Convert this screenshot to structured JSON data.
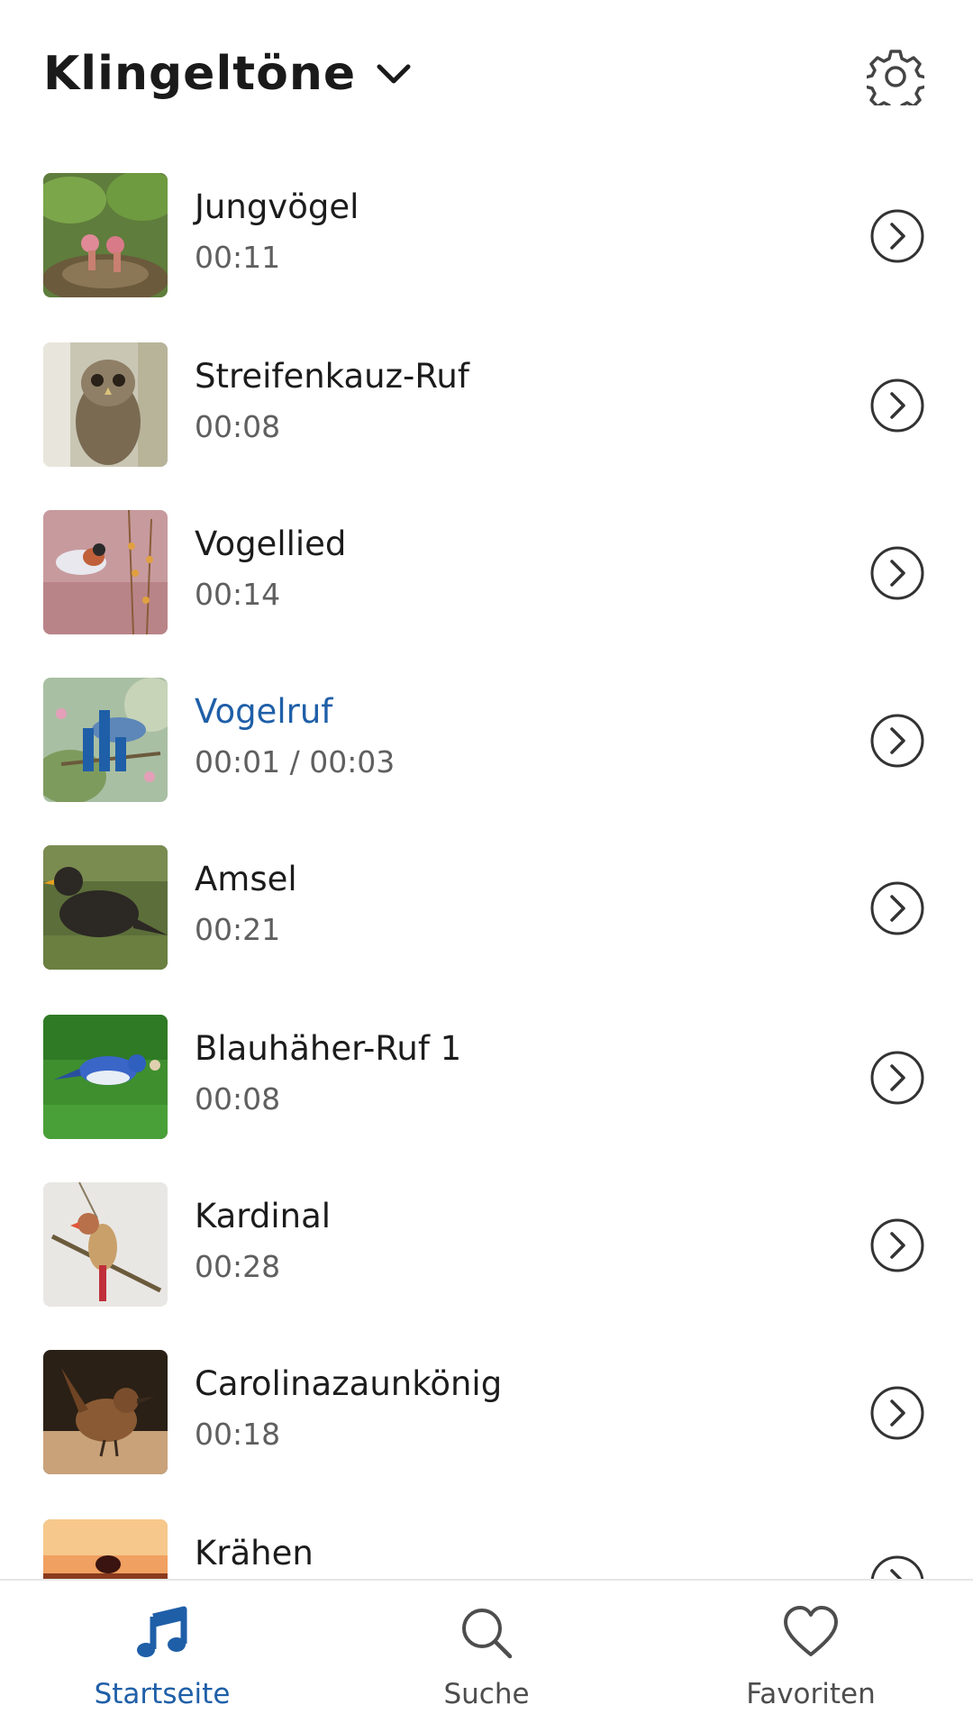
{
  "header": {
    "title": "Klingeltöne"
  },
  "ringtones": [
    {
      "name": "Jungvögel",
      "duration": "00:11"
    },
    {
      "name": "Streifenkauz-Ruf",
      "duration": "00:08"
    },
    {
      "name": "Vogellied",
      "duration": "00:14"
    },
    {
      "name": "Vogelruf",
      "duration": "00:01 / 00:03",
      "playing": true
    },
    {
      "name": "Amsel",
      "duration": "00:21"
    },
    {
      "name": "Blauhäher-Ruf 1",
      "duration": "00:08"
    },
    {
      "name": "Kardinal",
      "duration": "00:28"
    },
    {
      "name": "Carolinazaunkönig",
      "duration": "00:18"
    },
    {
      "name": "Krähen",
      "duration": ""
    }
  ],
  "tabs": [
    {
      "label": "Startseite",
      "icon": "music-note-icon",
      "active": true
    },
    {
      "label": "Suche",
      "icon": "search-icon",
      "active": false
    },
    {
      "label": "Favoriten",
      "icon": "heart-icon",
      "active": false
    }
  ],
  "colors": {
    "accent": "#1f5fa8",
    "text": "#1c1c1c",
    "secondary": "#5f5f5f"
  },
  "icons": {
    "header_dropdown": "chevron-down-icon",
    "settings": "gear-icon",
    "row_action": "chevron-right-circle-icon"
  }
}
